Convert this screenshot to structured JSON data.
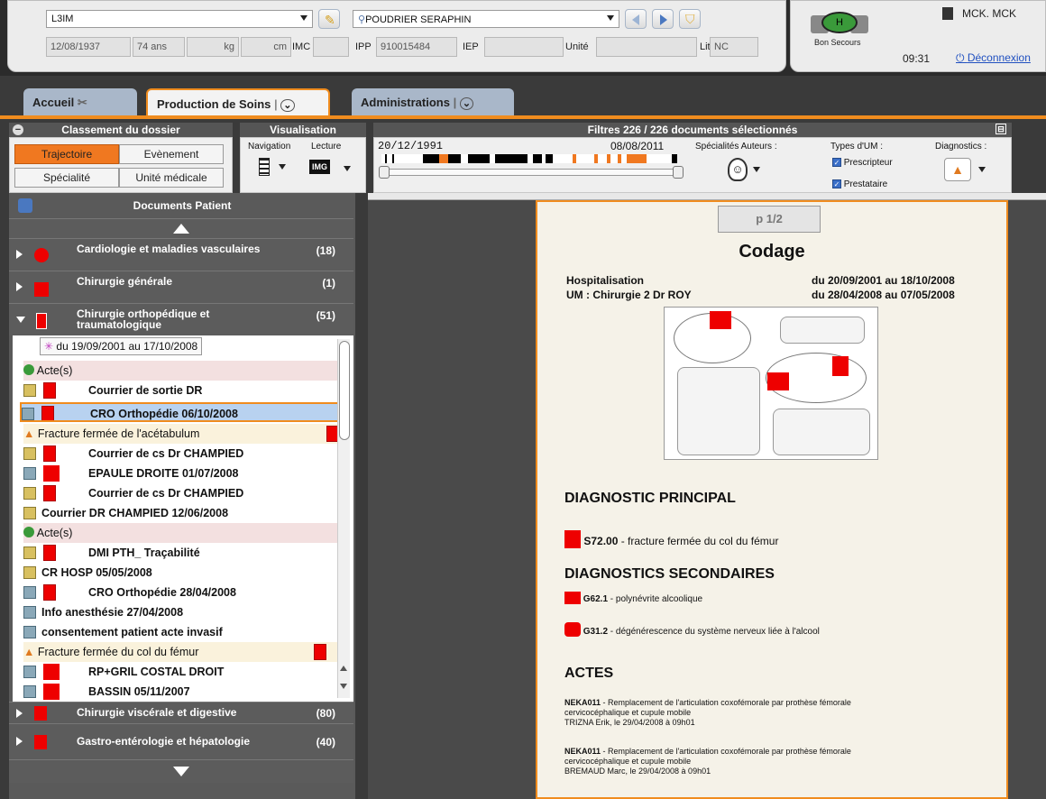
{
  "header": {
    "service_select": "L3IM",
    "patient_select": "POUDRIER SERAPHIN",
    "birthdate": "12/08/1937",
    "age": "74 ans",
    "weight_unit": "kg",
    "height_unit": "cm",
    "imc_label": "IMC",
    "ipp_label": "IPP",
    "ipp_value": "910015484",
    "iep_label": "IEP",
    "unite_label": "Unité",
    "lit_label": "Lit",
    "lit_value": "NC",
    "hospital": "Bon Secours",
    "user": "MCK. MCK",
    "time": "09:31",
    "logout": "Déconnexion"
  },
  "tabs": [
    {
      "label": "Accueil"
    },
    {
      "label": "Production de Soins"
    },
    {
      "label": "Administrations"
    }
  ],
  "classement": {
    "title": "Classement du dossier",
    "buttons": [
      "Trajectoire",
      "Evènement",
      "Spécialité",
      "Unité médicale"
    ]
  },
  "visualisation": {
    "title": "Visualisation",
    "navigation": "Navigation",
    "lecture": "Lecture",
    "img": "IMG"
  },
  "filtres": {
    "title": "Filtres 226 / 226 documents sélectionnés",
    "date_start": "20/12/1991",
    "date_end": "08/08/2011",
    "specialites": "Spécialités Auteurs :",
    "types_um": "Types d'UM :",
    "prescripteur": "Prescripteur",
    "prestataire": "Prestataire",
    "diagnostics": "Diagnostics :"
  },
  "documents": {
    "title": "Documents Patient",
    "categories": [
      {
        "name": "Cardiologie et maladies vasculaires",
        "count": "(18)"
      },
      {
        "name": "Chirurgie générale",
        "count": "(1)"
      },
      {
        "name": "Chirurgie orthopédique et traumatologique",
        "count": "(51)"
      },
      {
        "name": "Chirurgie viscérale et digestive",
        "count": "(80)"
      },
      {
        "name": "Gastro-entérologie et hépatologie",
        "count": "(40)"
      }
    ],
    "period": "du 19/09/2001 au 17/10/2008",
    "items": [
      "Acte(s)",
      "Courrier de sortie DR",
      "CRO Orthopédie 06/10/2008",
      "Fracture fermée de l'acétabulum",
      "Courrier de cs Dr CHAMPIED",
      "EPAULE DROITE 01/07/2008",
      "Courrier de cs Dr CHAMPIED",
      "Courrier DR CHAMPIED 12/06/2008",
      "Acte(s)",
      "DMI PTH_ Traçabilité",
      "CR HOSP 05/05/2008",
      "CRO Orthopédie 28/04/2008",
      "Info anesthésie 27/04/2008",
      "consentement patient acte invasif",
      "Fracture fermée du col du fémur",
      "RP+GRIL COSTAL DROIT",
      "BASSIN 05/11/2007"
    ]
  },
  "document": {
    "page": "p 1/2",
    "title": "Codage",
    "hosp_label": "Hospitalisation",
    "hosp_dates": "du 20/09/2001 au 18/10/2008",
    "um_label": "UM : Chirurgie 2 Dr ROY",
    "um_dates": "du 28/04/2008 au 07/05/2008",
    "diag_principal_title": "DIAGNOSTIC PRINCIPAL",
    "diag_principal_code": "S72.00",
    "diag_principal_text": " - fracture fermée du col du fémur",
    "diag_sec_title": "DIAGNOSTICS SECONDAIRES",
    "diag_sec": [
      {
        "code": "G62.1",
        "text": " - polynévrite alcoolique"
      },
      {
        "code": "G31.2",
        "text": " - dégénérescence du système nerveux liée à l'alcool"
      }
    ],
    "actes_title": "ACTES",
    "actes": [
      {
        "code": "NEKA011",
        "text": " - Remplacement de l'articulation coxofémorale par prothèse fémorale",
        "line2": "cervicocéphalique et cupule mobile",
        "line3": "TRIZNA Erik, le 29/04/2008 à 09h01"
      },
      {
        "code": "NEKA011",
        "text": " - Remplacement de l'articulation coxofémorale par prothèse fémorale",
        "line2": "cervicocéphalique et cupule mobile",
        "line3": "BREMAUD Marc, le 29/04/2008 à 09h01"
      }
    ]
  },
  "colors": {
    "accent": "#f08c1e",
    "dark": "#3a3a3a",
    "red": "#e00000"
  }
}
